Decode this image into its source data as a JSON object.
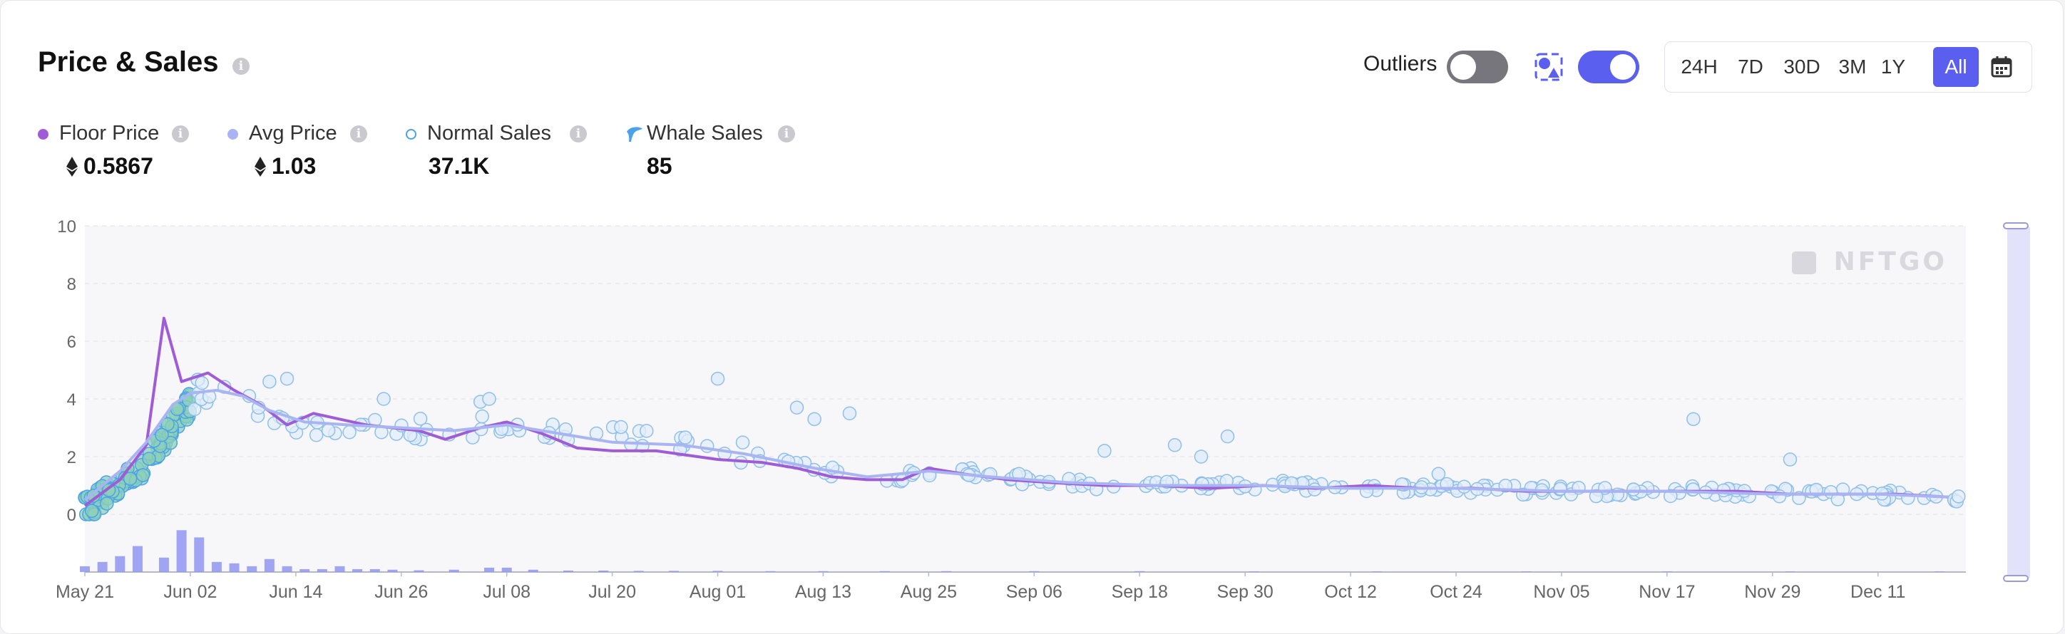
{
  "header": {
    "title": "Price & Sales"
  },
  "controls": {
    "outliers_label": "Outliers",
    "outliers_on": false,
    "whale_mode_on": true,
    "ranges": [
      "24H",
      "7D",
      "30D",
      "3M",
      "1Y",
      "All"
    ],
    "active_range": "All"
  },
  "legend": {
    "floor_price": {
      "label": "Floor Price",
      "value": "0.5867",
      "color": "#a05cd6"
    },
    "avg_price": {
      "label": "Avg Price",
      "value": "1.03",
      "color": "#a9b5f2"
    },
    "normal_sales": {
      "label": "Normal Sales",
      "value": "37.1K",
      "color": "#4aa3e8"
    },
    "whale_sales": {
      "label": "Whale Sales",
      "value": "85",
      "color": "#4aa3e8"
    }
  },
  "watermark": "NFTGO",
  "chart_data": {
    "type": "line",
    "x_tick_labels": [
      "May 21",
      "Jun 02",
      "Jun 14",
      "Jun 26",
      "Jul 08",
      "Jul 20",
      "Aug 01",
      "Aug 13",
      "Aug 25",
      "Sep 06",
      "Sep 18",
      "Sep 30",
      "Oct 12",
      "Oct 24",
      "Nov 05",
      "Nov 17",
      "Nov 29",
      "Dec 11"
    ],
    "x_start": "2022-05-21",
    "x_end": "2022-12-21",
    "y_ticks": [
      0,
      2,
      4,
      6,
      8,
      10
    ],
    "ylim": [
      -2,
      10
    ],
    "grid": true,
    "series": [
      {
        "name": "Floor Price",
        "type": "line",
        "color": "#a05cd6",
        "x": [
          "2022-05-21",
          "2022-05-25",
          "2022-05-28",
          "2022-05-30",
          "2022-06-01",
          "2022-06-04",
          "2022-06-07",
          "2022-06-10",
          "2022-06-13",
          "2022-06-16",
          "2022-06-19",
          "2022-06-22",
          "2022-06-25",
          "2022-06-28",
          "2022-07-01",
          "2022-07-05",
          "2022-07-08",
          "2022-07-12",
          "2022-07-16",
          "2022-07-20",
          "2022-07-25",
          "2022-08-01",
          "2022-08-06",
          "2022-08-10",
          "2022-08-14",
          "2022-08-18",
          "2022-08-22",
          "2022-08-25",
          "2022-08-29",
          "2022-09-03",
          "2022-09-08",
          "2022-09-14",
          "2022-09-20",
          "2022-09-26",
          "2022-10-02",
          "2022-10-08",
          "2022-10-14",
          "2022-10-20",
          "2022-10-26",
          "2022-11-01",
          "2022-11-07",
          "2022-11-13",
          "2022-11-19",
          "2022-11-25",
          "2022-12-01",
          "2022-12-07",
          "2022-12-13",
          "2022-12-19"
        ],
        "values": [
          0.3,
          1.2,
          2.4,
          6.8,
          4.6,
          4.9,
          4.3,
          3.8,
          3.1,
          3.5,
          3.3,
          3.1,
          3.0,
          2.9,
          2.6,
          3.0,
          3.2,
          2.8,
          2.3,
          2.2,
          2.2,
          1.9,
          1.8,
          1.6,
          1.3,
          1.2,
          1.2,
          1.6,
          1.4,
          1.2,
          1.1,
          1.0,
          1.0,
          0.9,
          1.0,
          0.9,
          1.0,
          0.9,
          0.9,
          0.8,
          0.8,
          0.8,
          0.8,
          0.8,
          0.7,
          0.7,
          0.7,
          0.6
        ]
      },
      {
        "name": "Avg Price",
        "type": "line",
        "color": "#a9b5f2",
        "x": [
          "2022-05-21",
          "2022-05-25",
          "2022-05-28",
          "2022-05-31",
          "2022-06-02",
          "2022-06-05",
          "2022-06-08",
          "2022-06-11",
          "2022-06-15",
          "2022-06-20",
          "2022-06-26",
          "2022-07-02",
          "2022-07-08",
          "2022-07-14",
          "2022-07-20",
          "2022-07-28",
          "2022-08-04",
          "2022-08-12",
          "2022-08-18",
          "2022-08-25",
          "2022-09-01",
          "2022-09-10",
          "2022-09-20",
          "2022-10-01",
          "2022-10-12",
          "2022-10-24",
          "2022-11-05",
          "2022-11-17",
          "2022-11-29",
          "2022-12-11",
          "2022-12-19"
        ],
        "values": [
          0.5,
          1.5,
          2.5,
          3.8,
          4.2,
          4.3,
          4.1,
          3.6,
          3.2,
          3.1,
          3.0,
          2.9,
          3.1,
          2.8,
          2.5,
          2.4,
          2.1,
          1.6,
          1.3,
          1.5,
          1.3,
          1.1,
          1.0,
          1.0,
          0.9,
          0.9,
          0.8,
          0.8,
          0.7,
          0.7,
          0.6
        ]
      }
    ],
    "normal_sales": {
      "color": "#4aa3e8",
      "anchors_x": [
        "2022-05-21",
        "2022-05-23",
        "2022-05-25",
        "2022-05-28",
        "2022-05-31",
        "2022-06-03",
        "2022-06-07",
        "2022-06-12",
        "2022-06-18",
        "2022-06-25",
        "2022-07-02",
        "2022-07-09",
        "2022-07-16",
        "2022-07-23",
        "2022-07-30",
        "2022-08-06",
        "2022-08-13",
        "2022-08-20",
        "2022-08-27",
        "2022-09-05",
        "2022-09-15",
        "2022-09-25",
        "2022-10-05",
        "2022-10-20",
        "2022-11-05",
        "2022-11-20",
        "2022-12-05",
        "2022-12-21"
      ],
      "anchors_y": [
        0.2,
        0.6,
        1.0,
        1.8,
        3.0,
        4.3,
        4.1,
        3.3,
        3.0,
        3.0,
        2.9,
        3.3,
        2.8,
        2.6,
        2.5,
        2.0,
        1.5,
        1.2,
        1.6,
        1.2,
        1.0,
        1.0,
        1.0,
        0.9,
        0.8,
        0.8,
        0.7,
        0.6
      ],
      "outliers": [
        {
          "x": "2022-08-01",
          "y": 4.7
        },
        {
          "x": "2022-08-10",
          "y": 3.7
        },
        {
          "x": "2022-08-12",
          "y": 3.3
        },
        {
          "x": "2022-08-16",
          "y": 3.5
        },
        {
          "x": "2022-06-24",
          "y": 4.0
        },
        {
          "x": "2022-07-05",
          "y": 3.9
        },
        {
          "x": "2022-07-06",
          "y": 4.0
        },
        {
          "x": "2022-09-14",
          "y": 2.2
        },
        {
          "x": "2022-09-22",
          "y": 2.4
        },
        {
          "x": "2022-09-25",
          "y": 2.0
        },
        {
          "x": "2022-09-28",
          "y": 2.7
        },
        {
          "x": "2022-10-22",
          "y": 1.4
        },
        {
          "x": "2022-11-20",
          "y": 3.3
        },
        {
          "x": "2022-12-01",
          "y": 1.9
        },
        {
          "x": "2022-06-13",
          "y": 4.7
        },
        {
          "x": "2022-06-11",
          "y": 4.6
        }
      ]
    },
    "volume_bars": {
      "color": "#8f97f0",
      "x": [
        "2022-05-21",
        "2022-05-23",
        "2022-05-25",
        "2022-05-27",
        "2022-05-30",
        "2022-06-01",
        "2022-06-03",
        "2022-06-05",
        "2022-06-07",
        "2022-06-09",
        "2022-06-11",
        "2022-06-13",
        "2022-06-15",
        "2022-06-17",
        "2022-06-19",
        "2022-06-21",
        "2022-06-23",
        "2022-06-25",
        "2022-06-28",
        "2022-07-02",
        "2022-07-06",
        "2022-07-08",
        "2022-07-11",
        "2022-07-15",
        "2022-07-19",
        "2022-07-23",
        "2022-07-27",
        "2022-08-01",
        "2022-08-07",
        "2022-08-13",
        "2022-08-20",
        "2022-08-27",
        "2022-09-06",
        "2022-09-18",
        "2022-10-01",
        "2022-10-15",
        "2022-11-01",
        "2022-11-17",
        "2022-12-01",
        "2022-12-18"
      ],
      "values": [
        0.2,
        0.35,
        0.55,
        0.9,
        0.5,
        1.45,
        1.2,
        0.35,
        0.3,
        0.2,
        0.45,
        0.2,
        0.1,
        0.1,
        0.2,
        0.1,
        0.1,
        0.08,
        0.06,
        0.08,
        0.15,
        0.15,
        0.08,
        0.05,
        0.05,
        0.04,
        0.04,
        0.04,
        0.03,
        0.03,
        0.03,
        0.03,
        0.03,
        0.03,
        0.02,
        0.02,
        0.02,
        0.02,
        0.02,
        0.02
      ]
    }
  }
}
